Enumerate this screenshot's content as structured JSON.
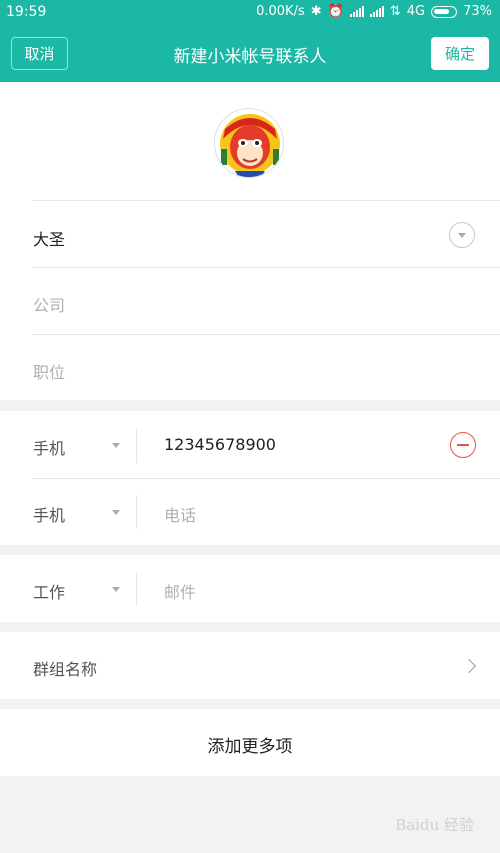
{
  "status_bar": {
    "time": "19:59",
    "net_speed": "0.00K/s",
    "network": "4G",
    "battery": "73%"
  },
  "appbar": {
    "cancel_label": "取消",
    "title": "新建小米帐号联系人",
    "confirm_label": "确定"
  },
  "name_section": {
    "name_value": "大圣",
    "company_placeholder": "公司",
    "position_placeholder": "职位"
  },
  "phone_section": {
    "rows": [
      {
        "type": "手机",
        "value": "12345678900",
        "placeholder": ""
      },
      {
        "type": "手机",
        "value": "",
        "placeholder": "电话"
      }
    ]
  },
  "email_section": {
    "type": "工作",
    "placeholder": "邮件"
  },
  "group_section": {
    "label": "群组名称"
  },
  "add_more_label": "添加更多项",
  "watermark": "Baidu 经验",
  "colors": {
    "accent": "#1cb8a6",
    "remove": "#e8533f"
  }
}
